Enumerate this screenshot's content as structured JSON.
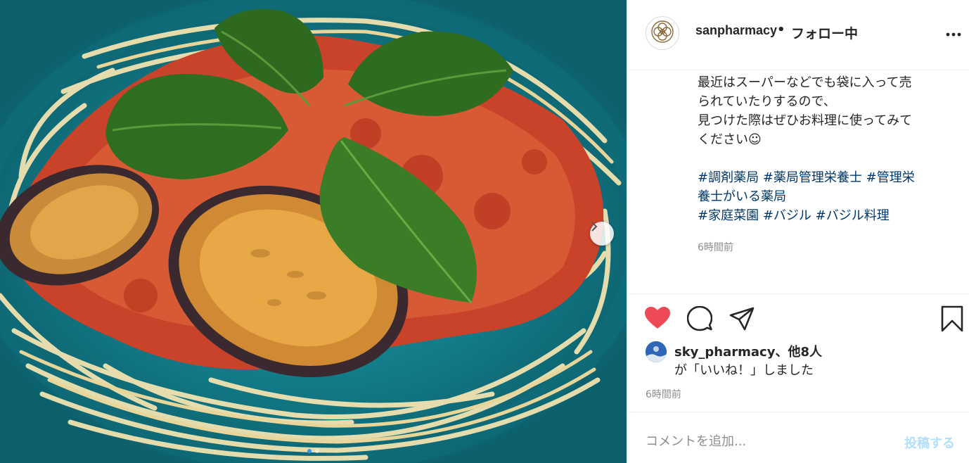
{
  "post": {
    "username": "sanpharmacy",
    "separator": "•",
    "follow_status": "フォロー中",
    "caption_clipped": "最近はスーパーなどでも袋に入って売",
    "caption_lines": [
      "られていたりするので、",
      "見つけた際はぜひお料理に使ってみて",
      "ください☺"
    ],
    "hashtags_line1": [
      "#調剤薬局",
      "#薬局管理栄養士",
      "#管理栄"
    ],
    "hashtags_line2": [
      "養士がいる薬局"
    ],
    "hashtags_line3": [
      "#家庭菜園",
      "#バジル",
      "#バジル料理"
    ],
    "caption_time": "6時間前",
    "likes_user": "sky_pharmacy",
    "likes_others": "、他8人",
    "likes_suffix": "が「いいね！」しました",
    "post_time": "6時間前",
    "comment_placeholder": "コメントを追加...",
    "post_button": "投稿する"
  },
  "carousel": {
    "total": 2,
    "active": 1
  },
  "colors": {
    "like_heart": "#ed4956",
    "hashtag": "#00376b",
    "post_button_disabled": "#b2dffc",
    "dot_active": "#3897f0"
  },
  "icons": [
    "brand-logo-icon",
    "more-options-icon",
    "heart-icon",
    "comment-icon",
    "share-icon",
    "bookmark-icon",
    "chevron-right-icon"
  ]
}
